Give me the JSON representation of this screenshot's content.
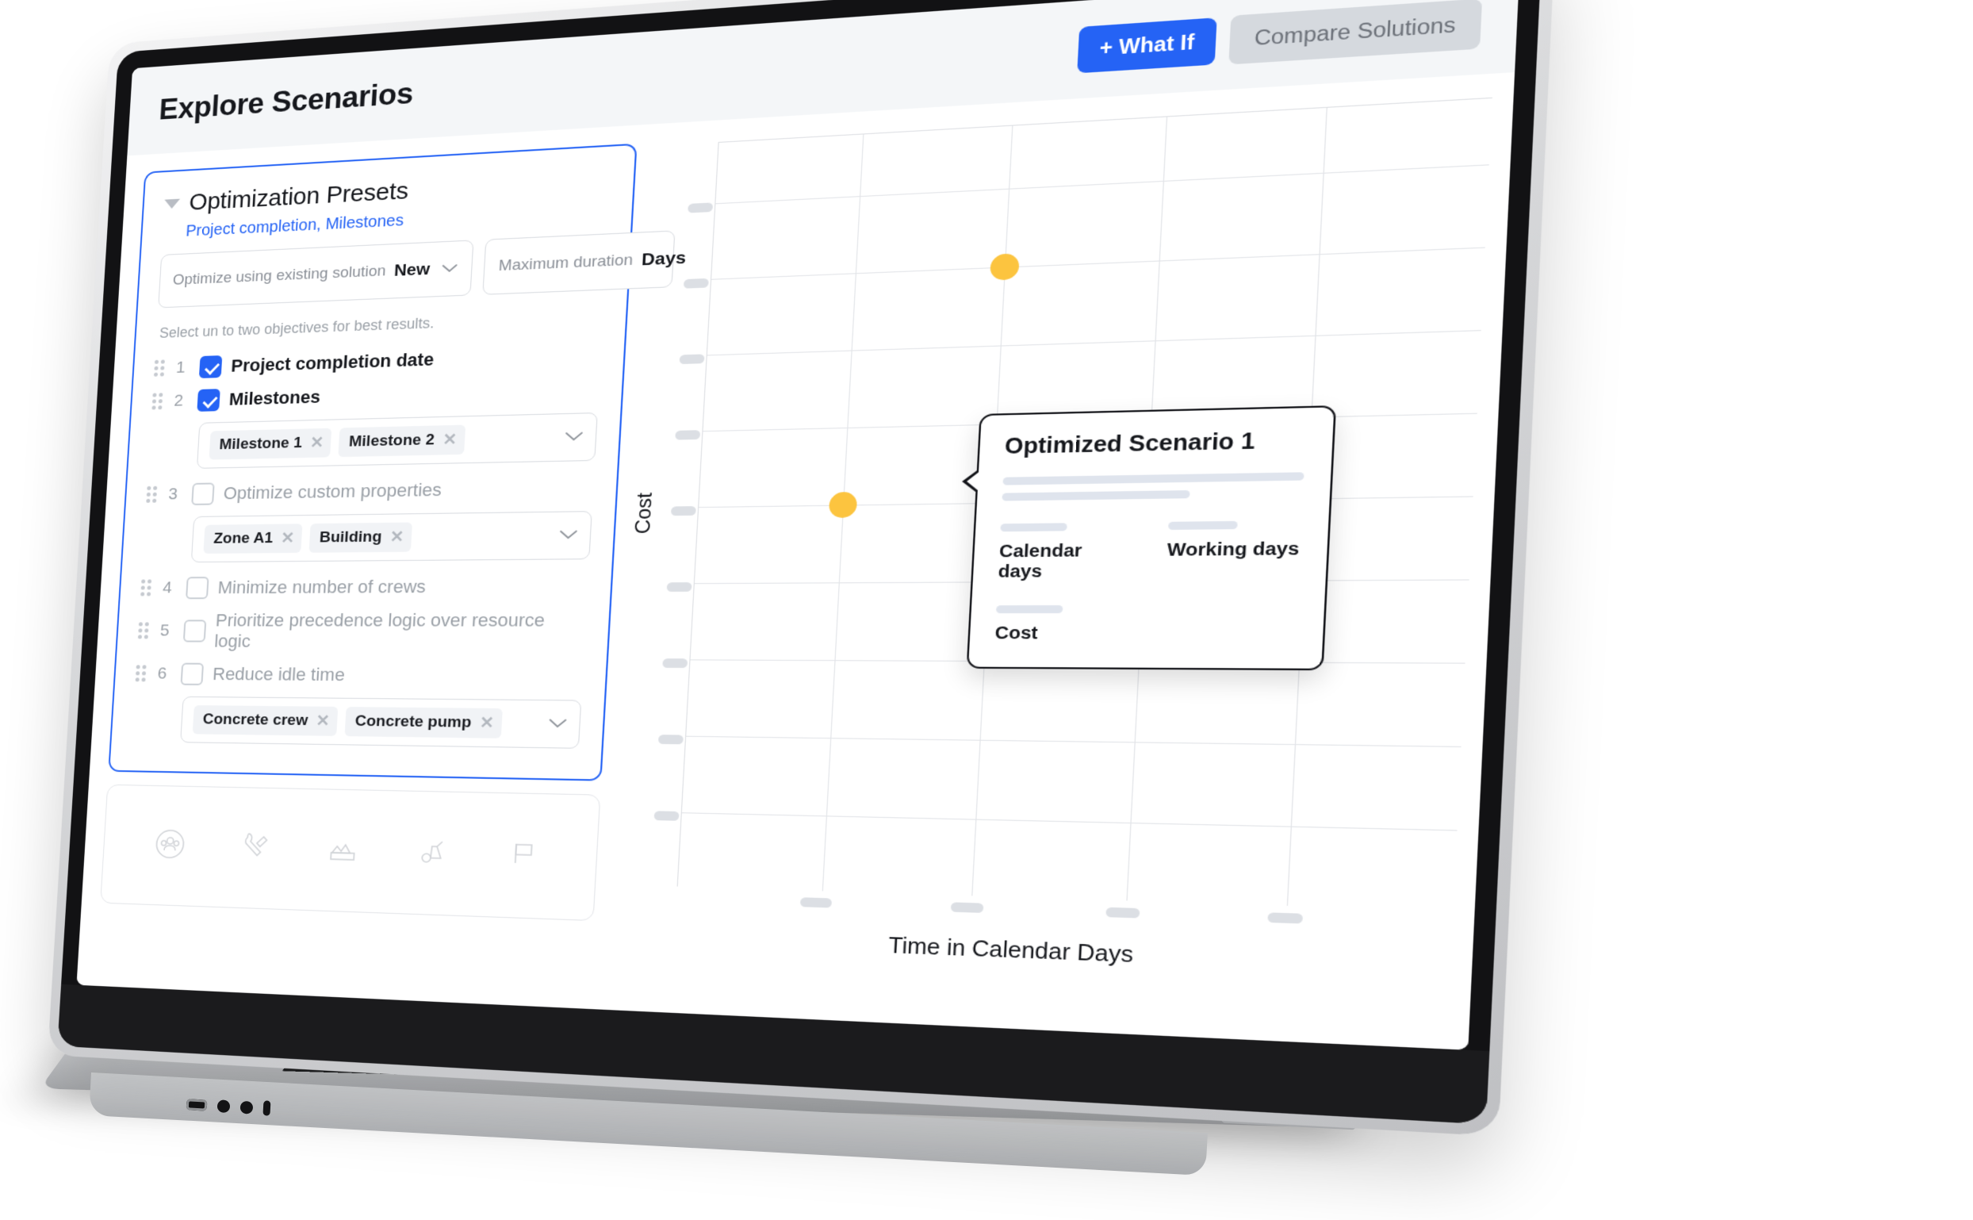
{
  "app": {
    "title": "Explore Scenarios",
    "actions": {
      "what_if": "+ What If",
      "compare": "Compare Solutions"
    },
    "accent_color": "#2563f5",
    "point_color": "#fcc43f"
  },
  "presets": {
    "title": "Optimization Presets",
    "subtitle": "Project completion, Milestones",
    "collapse_icon": "caret-down-icon",
    "solution_field": {
      "label": "Optimize using existing solution",
      "value": "New",
      "chevron_icon": "chevron-down-icon"
    },
    "duration_field": {
      "label": "Maximum duration",
      "value": "Days"
    },
    "hint": "Select un to two objectives for best results.",
    "objectives": [
      {
        "num": "1",
        "label": "Project completion date",
        "checked": true,
        "grip_icon": "drag-handle-icon",
        "tags": null
      },
      {
        "num": "2",
        "label": "Milestones",
        "checked": true,
        "grip_icon": "drag-handle-icon",
        "tags": [
          "Milestone 1",
          "Milestone 2"
        ]
      },
      {
        "num": "3",
        "label": "Optimize custom properties",
        "checked": false,
        "grip_icon": "drag-handle-icon",
        "tags": [
          "Zone A1",
          "Building"
        ]
      },
      {
        "num": "4",
        "label": "Minimize number of crews",
        "checked": false,
        "grip_icon": "drag-handle-icon",
        "tags": null
      },
      {
        "num": "5",
        "label": "Prioritize precedence logic over resource logic",
        "checked": false,
        "grip_icon": "drag-handle-icon",
        "tags": null
      },
      {
        "num": "6",
        "label": "Reduce idle time",
        "checked": false,
        "grip_icon": "drag-handle-icon",
        "tags": [
          "Concrete crew",
          "Concrete pump"
        ]
      }
    ],
    "tag_remove_icon": "close-icon",
    "tag_chevron_icon": "chevron-down-icon"
  },
  "toolbar": {
    "icons": [
      "crew-icon",
      "tools-icon",
      "material-icon",
      "equipment-icon",
      "flag-icon"
    ]
  },
  "tooltip": {
    "title": "Optimized Scenario 1",
    "skeleton_rows": [
      100,
      63
    ],
    "metrics": [
      {
        "label": "Calendar days",
        "value_skeleton": 52
      },
      {
        "label": "Working days",
        "value_skeleton": 52
      }
    ],
    "cost": {
      "label": "Cost",
      "value_skeleton": 52
    }
  },
  "chart_data": {
    "type": "scatter",
    "title": "",
    "xlabel": "Time in Calendar Days",
    "ylabel": "Cost",
    "grid": true,
    "legend": "none",
    "x_tick_labels": [
      "",
      "",
      "",
      ""
    ],
    "y_tick_labels": [
      "",
      "",
      "",
      "",
      "",
      "",
      "",
      "",
      ""
    ],
    "x_gridlines": 5,
    "y_gridlines": 9,
    "xlim": [
      0,
      100
    ],
    "ylim": [
      0,
      100
    ],
    "series": [
      {
        "name": "Optimized scenarios",
        "color": "#fcc43f",
        "points": [
          {
            "x": 37,
            "y": 79,
            "label": ""
          },
          {
            "x": 21,
            "y": 48,
            "label": "Optimized Scenario 1"
          }
        ]
      }
    ]
  }
}
